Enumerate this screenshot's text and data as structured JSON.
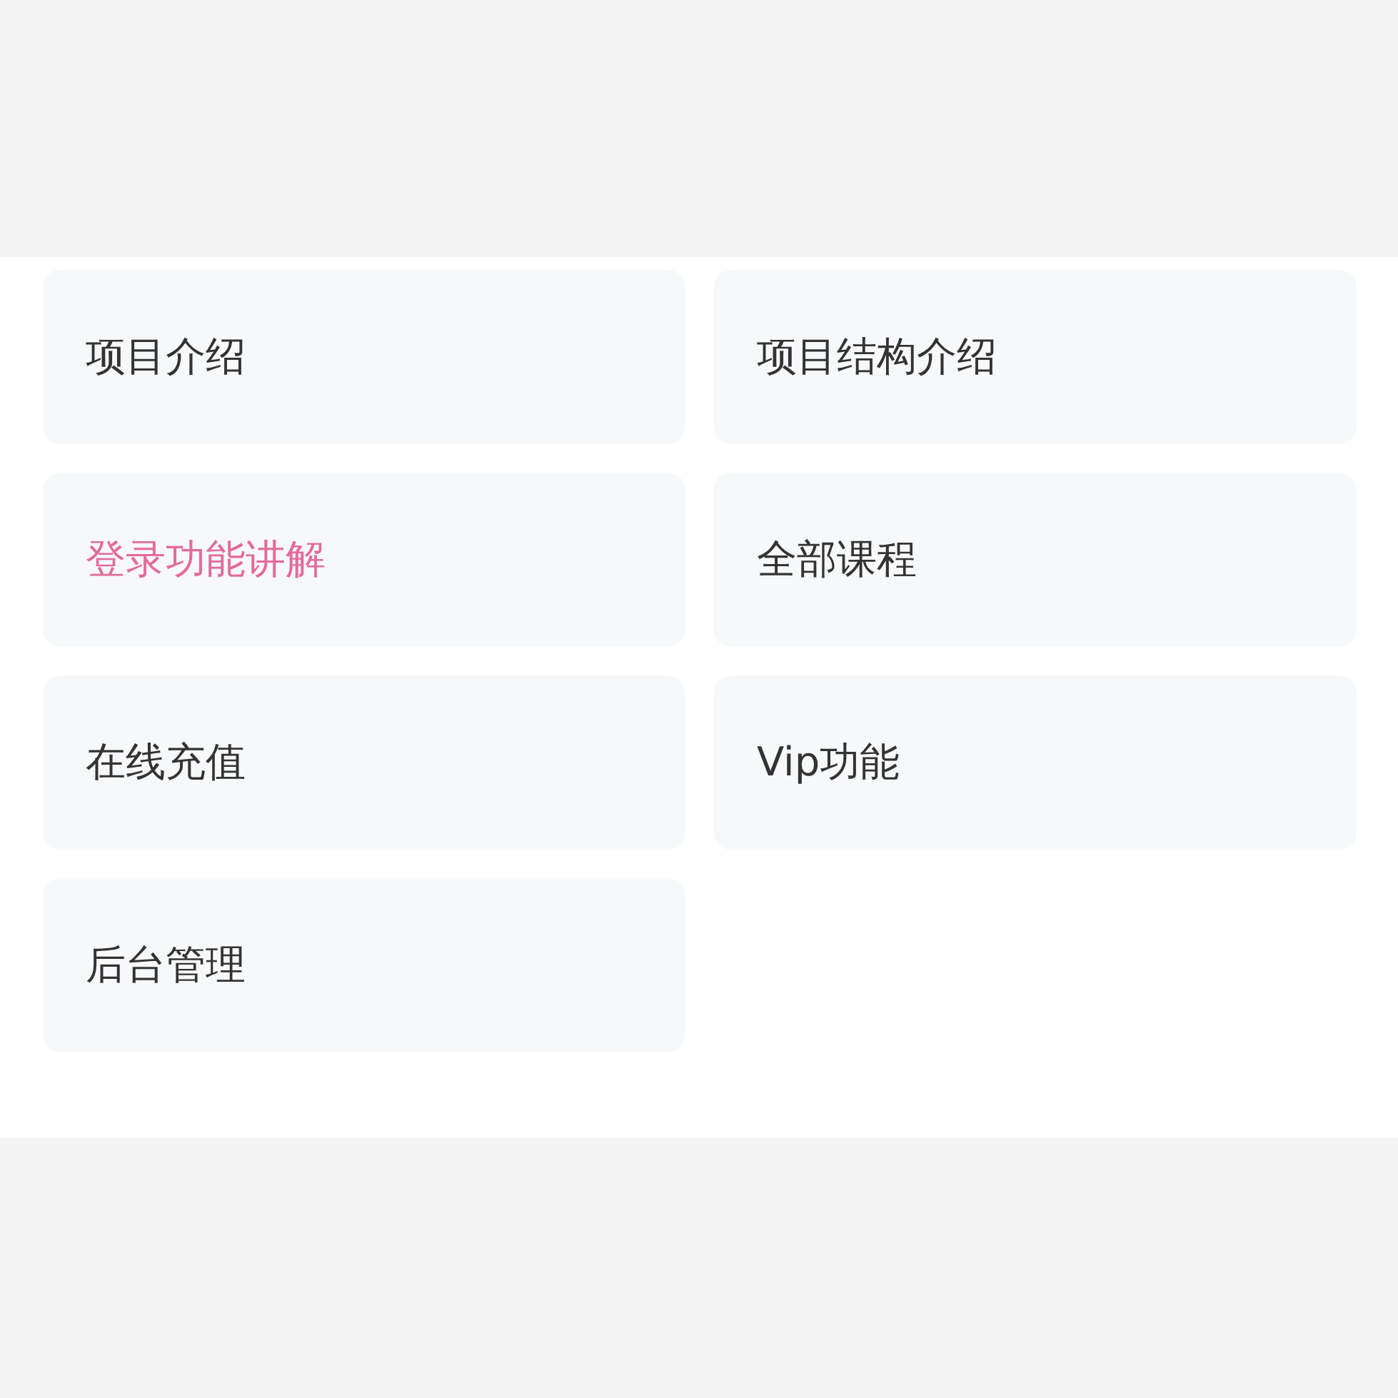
{
  "menu": [
    {
      "label": "项目介绍",
      "selected": false
    },
    {
      "label": "项目结构介绍",
      "selected": false
    },
    {
      "label": "登录功能讲解",
      "selected": true
    },
    {
      "label": "全部课程",
      "selected": false
    },
    {
      "label": "在线充值",
      "selected": false
    },
    {
      "label": "Vip功能",
      "selected": false
    },
    {
      "label": "后台管理",
      "selected": false
    }
  ]
}
